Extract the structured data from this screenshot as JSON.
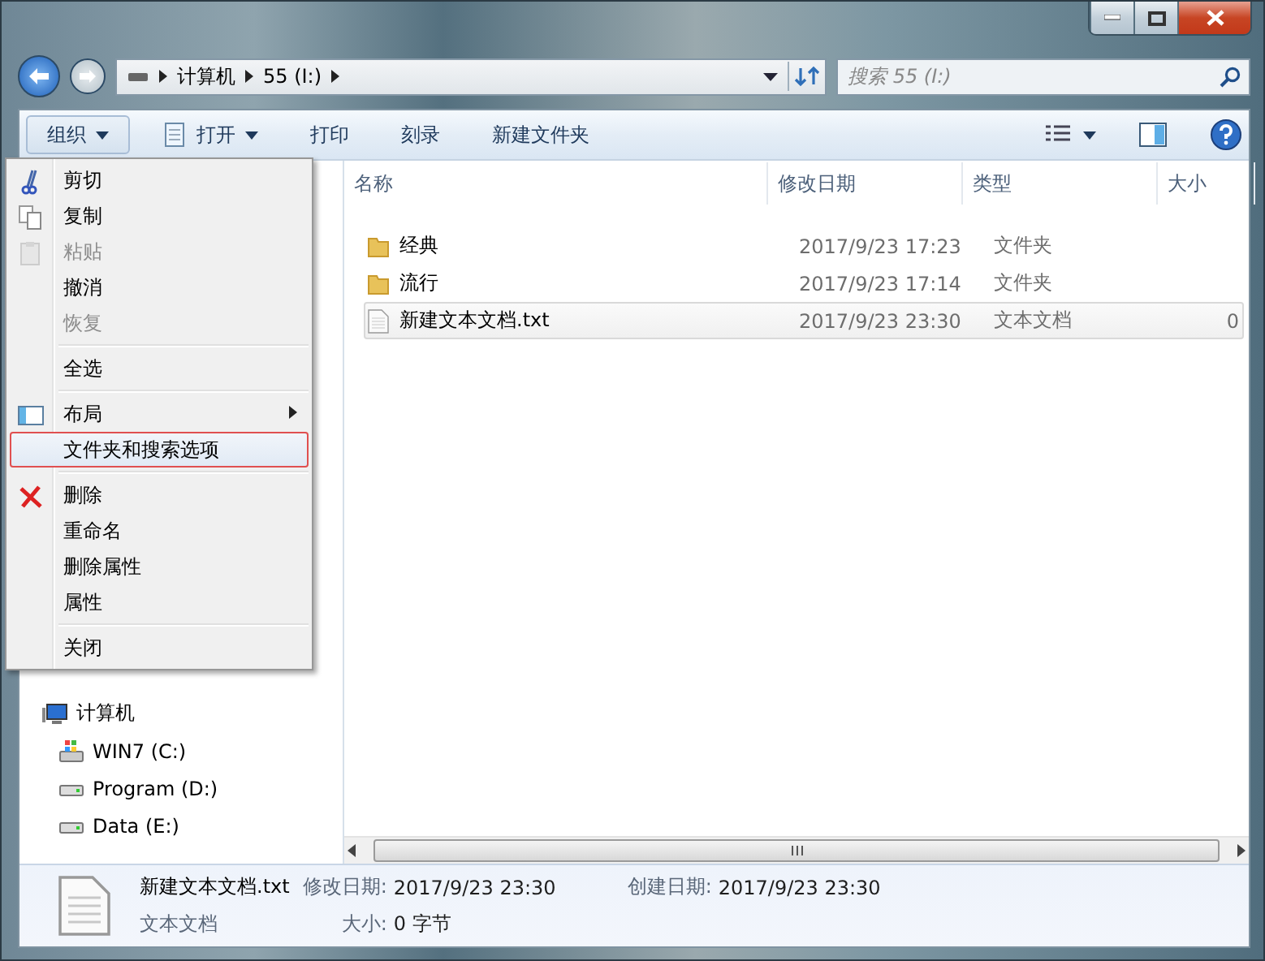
{
  "address": {
    "segments": [
      "计算机",
      "55 (I:)"
    ]
  },
  "search": {
    "placeholder": "搜索 55 (I:)"
  },
  "toolbar": [
    {
      "label": "组织",
      "has_menu": true,
      "selected": true,
      "kind": "plain"
    },
    {
      "label": "打开",
      "has_menu": true,
      "selected": false,
      "kind": "notepad"
    },
    {
      "label": "打印",
      "has_menu": false,
      "selected": false,
      "kind": "plain"
    },
    {
      "label": "刻录",
      "has_menu": false,
      "selected": false,
      "kind": "plain"
    },
    {
      "label": "新建文件夹",
      "has_menu": false,
      "selected": false,
      "kind": "plain"
    }
  ],
  "menu": [
    {
      "kind": "cut",
      "label": "剪切",
      "disabled": false,
      "selected": false,
      "submenu": false
    },
    {
      "kind": "copy",
      "label": "复制",
      "disabled": false,
      "selected": false,
      "submenu": false
    },
    {
      "kind": "paste",
      "label": "粘贴",
      "disabled": true,
      "selected": false,
      "submenu": false
    },
    {
      "kind": "plain",
      "label": "撤消",
      "disabled": false,
      "selected": false,
      "submenu": false
    },
    {
      "kind": "plain",
      "label": "恢复",
      "disabled": true,
      "selected": false,
      "submenu": false
    },
    {
      "kind": "separator"
    },
    {
      "kind": "plain",
      "label": "全选",
      "disabled": false,
      "selected": false,
      "submenu": false
    },
    {
      "kind": "separator"
    },
    {
      "kind": "layout",
      "label": "布局",
      "disabled": false,
      "selected": false,
      "submenu": true
    },
    {
      "kind": "plain",
      "label": "文件夹和搜索选项",
      "disabled": false,
      "selected": true,
      "submenu": false
    },
    {
      "kind": "separator"
    },
    {
      "kind": "delete",
      "label": "删除",
      "disabled": false,
      "selected": false,
      "submenu": false
    },
    {
      "kind": "plain",
      "label": "重命名",
      "disabled": false,
      "selected": false,
      "submenu": false
    },
    {
      "kind": "plain",
      "label": "删除属性",
      "disabled": false,
      "selected": false,
      "submenu": false
    },
    {
      "kind": "plain",
      "label": "属性",
      "disabled": false,
      "selected": false,
      "submenu": false
    },
    {
      "kind": "separator"
    },
    {
      "kind": "plain",
      "label": "关闭",
      "disabled": false,
      "selected": false,
      "submenu": false
    }
  ],
  "navigation": [
    {
      "kind": "computer",
      "label": "计算机",
      "children": [
        {
          "kind": "windows-drive",
          "label": "WIN7 (C:)"
        },
        {
          "kind": "drive",
          "label": "Program (D:)"
        },
        {
          "kind": "drive",
          "label": "Data (E:)"
        }
      ]
    }
  ],
  "table": {
    "columns": [
      "名称",
      "修改日期",
      "类型",
      "大小"
    ],
    "rows": [
      {
        "kind": "folder",
        "name": "经典",
        "date": "2017/9/23 17:23",
        "type": "文件夹",
        "hot": false
      },
      {
        "kind": "folder",
        "name": "流行",
        "date": "2017/9/23 17:14",
        "type": "文件夹",
        "hot": false
      },
      {
        "kind": "text",
        "name": "新建文本文档.txt",
        "date": "2017/9/23 23:30",
        "type": "文本文档",
        "size": "0",
        "hot": true
      }
    ]
  },
  "details": {
    "rows": [
      {
        "title": "新建文本文档.txt",
        "fields": [
          {
            "label": "修改日期:",
            "value": "2017/9/23 23:30"
          },
          {
            "label": "创建日期:",
            "value": "2017/9/23 23:30"
          }
        ]
      },
      {
        "title": "文本文档",
        "fields": [
          {
            "label": "大小:",
            "value": "0 字节"
          }
        ]
      }
    ]
  }
}
